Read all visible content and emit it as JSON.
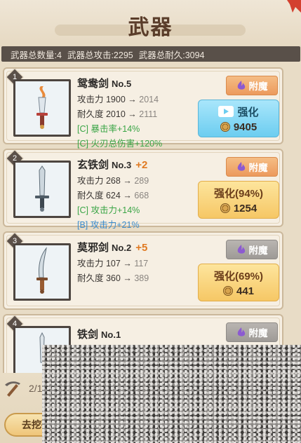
{
  "header": {
    "title": "武器"
  },
  "stats": {
    "count": "武器总数量:4",
    "attack": "武器总攻击:2295",
    "durability": "武器总耐久:3094"
  },
  "weapons": [
    {
      "index": "1",
      "name": "鸳鸯剑",
      "no": "No.5",
      "plus": "",
      "attack": "攻击力 1900",
      "attack_next": "2014",
      "durability": "耐久度 2010",
      "durability_next": "2111",
      "bonuses": [
        {
          "text": "[C] 暴击率+14%",
          "grade": "C"
        },
        {
          "text": "[C] 火刃总伤害+120%",
          "grade": "C"
        }
      ],
      "enchant_label": "附魔",
      "enchant_active": true,
      "upgrade_label": "强化",
      "upgrade_type": "video",
      "cost": "9405"
    },
    {
      "index": "2",
      "name": "玄铁剑",
      "no": "No.3",
      "plus": "+2",
      "attack": "攻击力 268",
      "attack_next": "289",
      "durability": "耐久度 624",
      "durability_next": "668",
      "bonuses": [
        {
          "text": "[C] 攻击力+14%",
          "grade": "C"
        },
        {
          "text": "[B] 攻击力+21%",
          "grade": "B"
        }
      ],
      "enchant_label": "附魔",
      "enchant_active": true,
      "upgrade_label": "强化(94%)",
      "upgrade_type": "gold",
      "cost": "1254"
    },
    {
      "index": "3",
      "name": "莫邪剑",
      "no": "No.2",
      "plus": "+5",
      "attack": "攻击力 107",
      "attack_next": "117",
      "durability": "耐久度 360",
      "durability_next": "389",
      "bonuses": [],
      "enchant_label": "附魔",
      "enchant_active": false,
      "upgrade_label": "强化(69%)",
      "upgrade_type": "gold",
      "cost": "441"
    },
    {
      "index": "4",
      "name": "铁剑",
      "no": "No.1",
      "plus": "",
      "enchant_label": "附魔",
      "enchant_active": false
    }
  ],
  "bottom": {
    "mine_count": "2/17",
    "go_mine_label": "去挖矿 >"
  },
  "colors": {
    "enchant_active": "#ec9a5d",
    "upgrade_video": "#6ccdf0",
    "upgrade_gold": "#f6c765",
    "bonus_c": "#3aa546",
    "bonus_b": "#3c8ccc",
    "plus": "#e07a22"
  }
}
